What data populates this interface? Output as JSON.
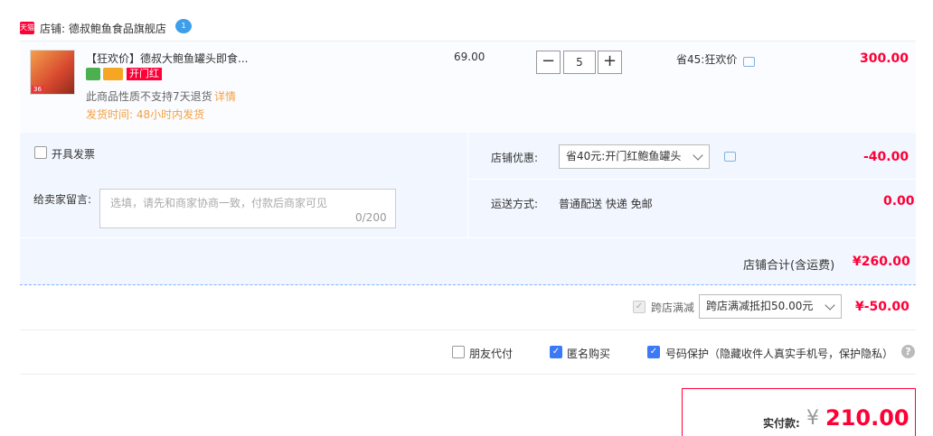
{
  "shop": {
    "badge": "天猫",
    "name": "店铺: 德叔鲍鱼食品旗舰店",
    "chat_badge": "1"
  },
  "item": {
    "thumb_badge": "36",
    "title": "【狂欢价】德叔大鲍鱼罐头即食...",
    "tag": "开门红",
    "no_return": "此商品性质不支持7天退货",
    "detail_link": "详情",
    "ship_time": "发货时间: 48小时内发货",
    "unit_price": "69.00",
    "qty_minus": "−",
    "qty": "5",
    "qty_plus": "+",
    "save_text": "省45:狂欢价",
    "total": "300.00"
  },
  "order": {
    "invoice_label": "开具发票",
    "message_label": "给卖家留言:",
    "message_placeholder": "选填，请先和商家协商一致，付款后商家可见",
    "message_count": "0/200",
    "shop_discount_label": "店铺优惠:",
    "shop_discount_option": "省40元:开门红鲍鱼罐头",
    "shop_discount_amount": "-40.00",
    "shipping_label": "运送方式:",
    "shipping_value": "普通配送 快递 免邮",
    "shipping_amount": "0.00",
    "shop_total_label": "店铺合计(含运费)",
    "shop_total_value": "¥260.00"
  },
  "cross_store": {
    "label": "跨店满减",
    "option": "跨店满减抵扣50.00元",
    "amount": "¥-50.00"
  },
  "options": {
    "friend_pay": "朋友代付",
    "anonymous": "匿名购买",
    "privacy": "号码保护（隐藏收件人真实手机号，保护隐私）",
    "help": "?"
  },
  "payment": {
    "label": "实付款:",
    "currency": "¥",
    "amount": "210.00"
  },
  "colors": {
    "accent_red": "#ff0036",
    "checkbox_blue": "#3b79f7",
    "panel_blue": "#f2f7ff"
  }
}
